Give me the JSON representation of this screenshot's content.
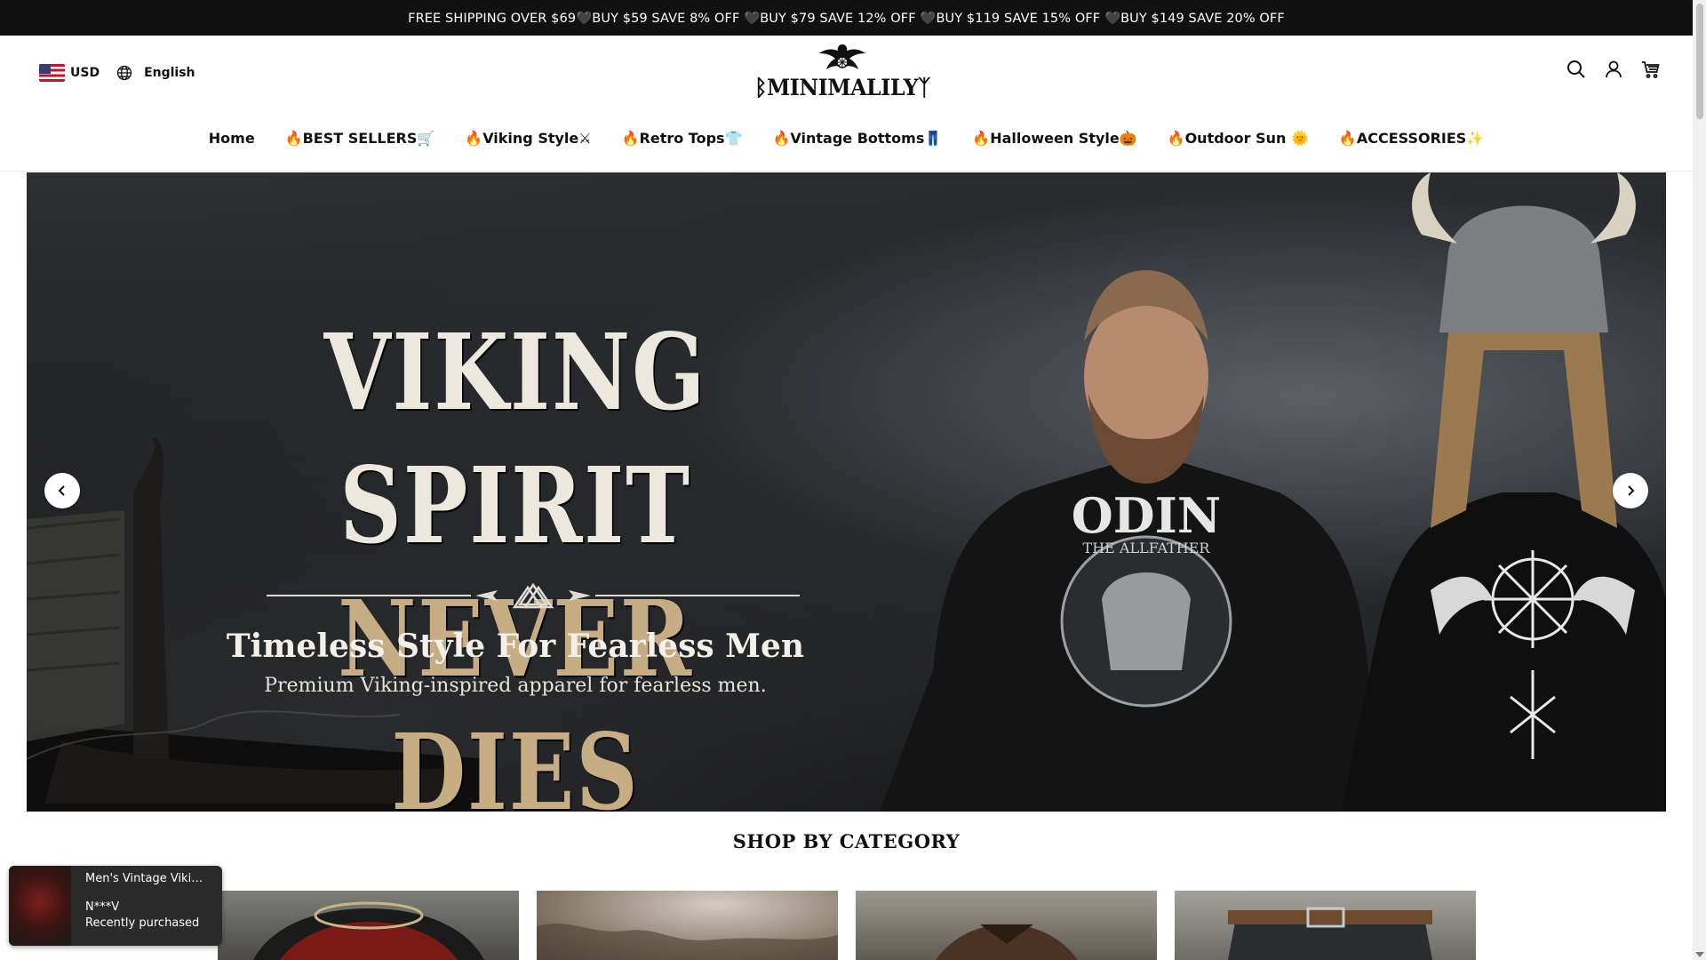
{
  "announcement": "FREE SHIPPING OVER $69🖤BUY $59 SAVE 8% OFF 🖤BUY $79 SAVE 12% OFF 🖤BUY $119 SAVE 15% OFF 🖤BUY $149 SAVE 20% OFF",
  "header": {
    "currency": "USD",
    "language": "English",
    "logo_text": "ᛒMINIMALILYᛉ",
    "icons": [
      "search-icon",
      "account-icon",
      "cart-icon"
    ]
  },
  "nav": {
    "items": [
      {
        "label": "Home"
      },
      {
        "label": "🔥BEST SELLERS🛒"
      },
      {
        "label": "🔥Viking Style⚔"
      },
      {
        "label": "🔥Retro Tops👕"
      },
      {
        "label": "🔥Vintage Bottoms👖"
      },
      {
        "label": "🔥Halloween Style🎃"
      },
      {
        "label": "🔥Outdoor Sun 🌞"
      },
      {
        "label": "🔥ACCESSORIES✨"
      }
    ]
  },
  "hero": {
    "title_line1": "VIKING SPIRIT",
    "title_line2": "NEVER DIES",
    "subtitle": "Timeless Style For Fearless Men",
    "tagline": "Premium Viking-inspired apparel for fearless men.",
    "shirt_front_text": "ODIN",
    "shirt_front_sub": "THE ALLFATHER"
  },
  "category_section": {
    "title": "SHOP BY CATEGORY"
  },
  "toast": {
    "product": "Men's Vintage Viking Odin T-Shirt",
    "buyer": "N***V",
    "status": "Recently purchased"
  },
  "colors": {
    "announcement_bg": "#111111",
    "accent_gold": "#c6ad83"
  }
}
